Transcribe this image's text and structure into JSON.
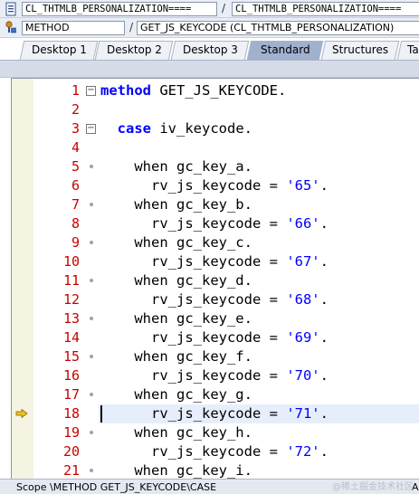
{
  "toolbar": {
    "object_field_1": "CL_THTMLB_PERSONALIZATION====",
    "separator_1": "/",
    "object_field_2": "CL_THTMLB_PERSONALIZATION====",
    "type_field": "METHOD",
    "separator_2": "/",
    "name_field": "GET_JS_KEYCODE (CL_THTMLB_PERSONALIZATION)"
  },
  "tabs": [
    {
      "label": "Desktop 1",
      "active": false
    },
    {
      "label": "Desktop 2",
      "active": false
    },
    {
      "label": "Desktop 3",
      "active": false
    },
    {
      "label": "Standard",
      "active": true
    },
    {
      "label": "Structures",
      "active": false
    },
    {
      "label": "Ta",
      "active": false
    }
  ],
  "editor": {
    "current_line": 18,
    "lines": [
      {
        "no": "1",
        "text": "method GET_JS_KEYCODE."
      },
      {
        "no": "2",
        "text": ""
      },
      {
        "no": "3",
        "text": "  case iv_keycode."
      },
      {
        "no": "4",
        "text": ""
      },
      {
        "no": "5",
        "text": "    when gc_key_a."
      },
      {
        "no": "6",
        "text": "      rv_js_keycode = '65'."
      },
      {
        "no": "7",
        "text": "    when gc_key_b."
      },
      {
        "no": "8",
        "text": "      rv_js_keycode = '66'."
      },
      {
        "no": "9",
        "text": "    when gc_key_c."
      },
      {
        "no": "10",
        "text": "      rv_js_keycode = '67'."
      },
      {
        "no": "11",
        "text": "    when gc_key_d."
      },
      {
        "no": "12",
        "text": "      rv_js_keycode = '68'."
      },
      {
        "no": "13",
        "text": "    when gc_key_e."
      },
      {
        "no": "14",
        "text": "      rv_js_keycode = '69'."
      },
      {
        "no": "15",
        "text": "    when gc_key_f."
      },
      {
        "no": "16",
        "text": "      rv_js_keycode = '70'."
      },
      {
        "no": "17",
        "text": "    when gc_key_g."
      },
      {
        "no": "18",
        "text": "      rv_js_keycode = '71'."
      },
      {
        "no": "19",
        "text": "    when gc_key_h."
      },
      {
        "no": "20",
        "text": "      rv_js_keycode = '72'."
      },
      {
        "no": "21",
        "text": "    when gc_key_i."
      }
    ]
  },
  "status": {
    "scope": "Scope \\METHOD GET_JS_KEYCODE\\CASE",
    "right": "AB",
    "watermark": "@稀土掘金技术社区"
  },
  "colors": {
    "keyword": "#0000ff",
    "string": "#0000ff",
    "line_number": "#cc0000",
    "active_tab": "#9fb1cf",
    "current_line_bg": "#e7eefb"
  },
  "icons": {
    "toolbar_row_1": "document-icon",
    "toolbar_row_2": "method-icon",
    "current_line_marker": "arrow-right-icon"
  }
}
